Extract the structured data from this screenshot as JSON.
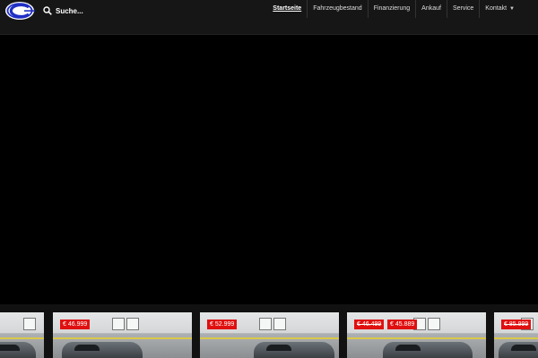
{
  "header": {
    "search_placeholder": "Suche..."
  },
  "nav": {
    "items": [
      {
        "label": "Startseite",
        "active": true
      },
      {
        "label": "Fahrzeugbestand"
      },
      {
        "label": "Finanzierung"
      },
      {
        "label": "Ankauf"
      },
      {
        "label": "Service"
      },
      {
        "label": "Kontakt",
        "has_dropdown": true
      }
    ]
  },
  "colors": {
    "logo_blue": "#1f2fc4",
    "price_red": "#e01010",
    "header_bg": "#161616"
  },
  "icons": {
    "logo": "company-logo-icon",
    "search": "search-icon",
    "dropdown": "chevron-down-icon"
  },
  "listings": [
    {
      "prices": []
    },
    {
      "prices": [
        {
          "text": "€ 46.999"
        }
      ]
    },
    {
      "prices": [
        {
          "text": "€ 52.999"
        }
      ]
    },
    {
      "prices": [
        {
          "text": "€ 46.499",
          "strikethrough": true
        },
        {
          "text": "€ 45.889"
        }
      ]
    },
    {
      "prices": [
        {
          "text": "€ 85.999",
          "strikethrough": true
        }
      ]
    }
  ]
}
